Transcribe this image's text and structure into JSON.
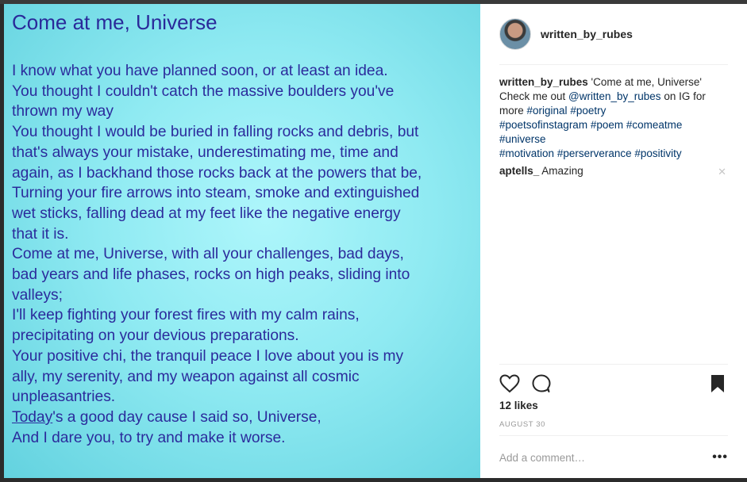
{
  "poem": {
    "title": "Come at me, Universe",
    "lines": [
      "I know what you have planned soon, or at least an idea.",
      "You thought I couldn't catch the massive boulders you've",
      "thrown my way",
      "You thought I would be buried in falling rocks and debris, but",
      "that's always your mistake, underestimating me, time and",
      "again, as I backhand those rocks back at the powers that be,",
      "Turning your fire arrows into steam, smoke and extinguished",
      "wet sticks, falling dead at my feet like the negative energy",
      "that it is.",
      "Come at me, Universe, with all your challenges, bad days,",
      "bad years and life phases, rocks on high peaks, sliding into",
      "valleys;",
      "I'll keep fighting your forest fires with my calm rains,",
      "precipitating on your devious preparations.",
      "Your positive chi, the tranquil peace I love about you is my",
      "ally, my serenity,  and my weapon against all cosmic",
      "unpleasantries."
    ],
    "last_line_link": "Today",
    "last_line_rest": "'s a good day cause I said so, Universe,",
    "final_line": "And I dare you, to try and make it worse."
  },
  "header": {
    "username": "written_by_rubes"
  },
  "caption": {
    "username": "written_by_rubes",
    "text": " 'Come at me, Universe' Check me out ",
    "mention": "@written_by_rubes",
    "text2": " on IG for more ",
    "tags": [
      "#original",
      "#poetry",
      "#poetsofinstagram",
      "#poem",
      "#comeatme",
      "#universe",
      "#motivation",
      "#perserverance",
      "#positivity"
    ]
  },
  "comments": [
    {
      "username": "aptells_",
      "text": " Amazing"
    }
  ],
  "likes": "12 likes",
  "date": "AUGUST 30",
  "add_comment": {
    "placeholder": "Add a comment…"
  },
  "icons": {
    "like": "heart-icon",
    "comment": "comment-bubble-icon",
    "save": "bookmark-icon",
    "more": "more-options-icon",
    "remove": "close-icon"
  }
}
